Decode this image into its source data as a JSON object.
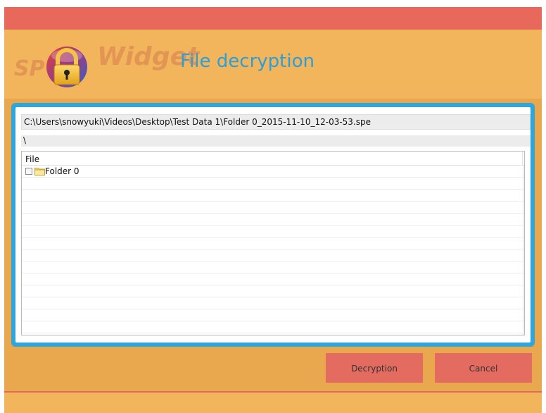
{
  "app": {
    "logo_text_left": "SP",
    "logo_text_right": "Widget",
    "title": "File decryption"
  },
  "decryption": {
    "file_path": "C:\\Users\\snowyuki\\Videos\\Desktop\\Test Data 1\\Folder 0_2015-11-10_12-03-53.spe",
    "current_folder": "\\",
    "table": {
      "column_header": "File",
      "rows": [
        {
          "name": "Folder 0",
          "checked": false,
          "icon": "folder-icon"
        }
      ]
    }
  },
  "buttons": {
    "decrypt_label": "Decryption",
    "cancel_label": "Cancel"
  },
  "colors": {
    "title_bar": "#e8685c",
    "window_bg": "#e9a84e",
    "header_bg": "#f2b55c",
    "accent_blue": "#2ea6dc",
    "button": "#e46b5f"
  }
}
